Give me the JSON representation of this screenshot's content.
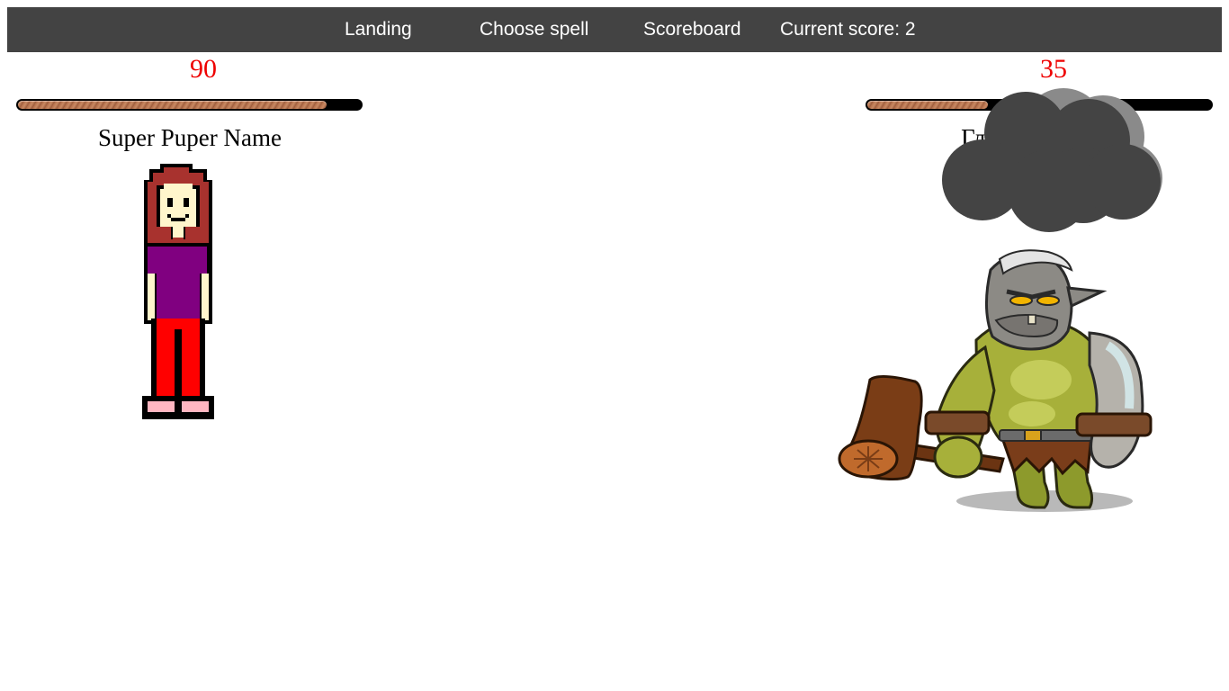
{
  "nav": {
    "landing": "Landing",
    "choose_spell": "Choose spell",
    "scoreboard": "Scoreboard",
    "score_label": "Current score: 2"
  },
  "player": {
    "hp": "90",
    "hp_fraction": 0.9,
    "name": "Super Puper Name"
  },
  "enemy": {
    "hp": "35",
    "hp_fraction": 0.35,
    "name": "Глупый Тролль",
    "effect_icon": "storm-cloud-icon"
  },
  "colors": {
    "nav_bg": "#434343",
    "hp_text": "#ee0000",
    "hp_bar_track": "#000000",
    "hp_bar_fill": "#b06b47",
    "cloud": "#444444"
  }
}
